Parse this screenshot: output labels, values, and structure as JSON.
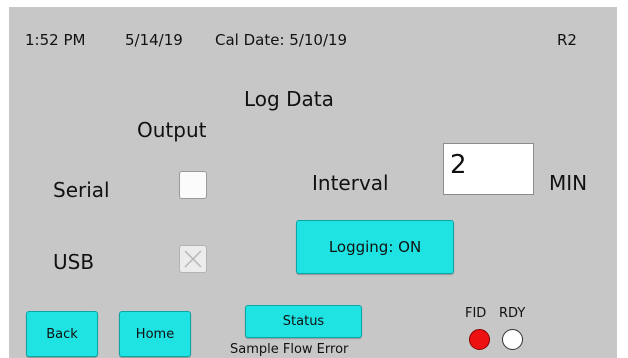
{
  "status_bar": {
    "time": "1:52 PM",
    "date": "5/14/19",
    "cal_date": "Cal Date: 5/10/19",
    "channel": "R2"
  },
  "title": "Log Data",
  "output_label": "Output",
  "serial": {
    "label": "Serial",
    "checked": false
  },
  "usb": {
    "label": "USB",
    "checked": true,
    "disabled": true
  },
  "interval": {
    "label": "Interval",
    "value": "2",
    "unit": "MIN"
  },
  "logging_button": "Logging: ON",
  "nav": {
    "back": "Back",
    "home": "Home",
    "status": "Status"
  },
  "error_message": "Sample Flow Error",
  "indicators": {
    "fid_label": "FID",
    "rdy_label": "RDY",
    "fid_color": "#ee1111",
    "rdy_color": "#ffffff"
  },
  "colors": {
    "background": "#c7c7c7",
    "button": "#1fe3e3"
  }
}
